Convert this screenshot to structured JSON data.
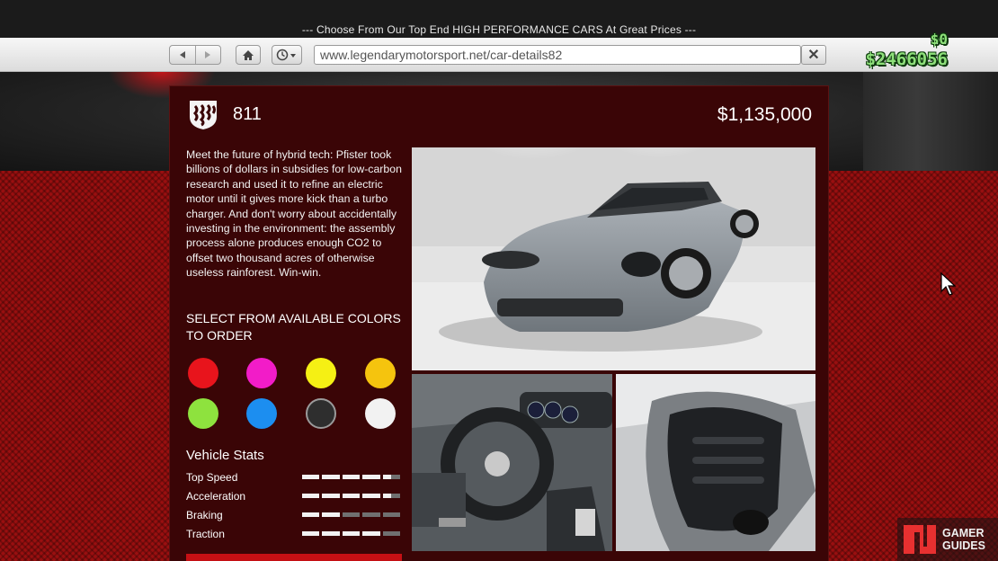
{
  "banner": {
    "title": "--- Choose From Our Top End HIGH PERFORMANCE CARS At Great Prices ---"
  },
  "browser": {
    "back_icon": "back-arrow-icon",
    "forward_icon": "forward-arrow-icon",
    "home_icon": "home-icon",
    "history_icon": "history-clock-icon",
    "url": "www.legendarymotorsport.net/car-details82",
    "close_icon": "close-icon",
    "close_label": "✕"
  },
  "hud": {
    "cash_small": "$0",
    "cash_big": "$2466056"
  },
  "car": {
    "name": "811",
    "price": "$1,135,000",
    "brand_logo": "pfister-logo",
    "description": "Meet the future of hybrid tech: Pfister took billions of dollars in subsidies for low-carbon research and used it to refine an electric motor until it gives more kick than a turbo charger. And don't worry about accidentally investing in the environment: the assembly process alone produces enough CO2 to offset two thousand acres of otherwise useless rainforest. Win-win."
  },
  "colors": {
    "heading": "SELECT FROM AVAILABLE COLORS TO ORDER",
    "swatches": [
      {
        "hex": "#e8141c"
      },
      {
        "hex": "#f21cc8"
      },
      {
        "hex": "#f5f014"
      },
      {
        "hex": "#f5c40e"
      },
      {
        "hex": "#8ee23e"
      },
      {
        "hex": "#1c8ef0"
      },
      {
        "hex": "#2e2e2e",
        "selected": true
      },
      {
        "hex": "#f2f2f2"
      }
    ]
  },
  "stats": {
    "heading": "Vehicle Stats",
    "items": [
      {
        "label": "Top Speed",
        "fraction": 0.9
      },
      {
        "label": "Acceleration",
        "fraction": 0.9
      },
      {
        "label": "Braking",
        "fraction": 0.4
      },
      {
        "label": "Traction",
        "fraction": 0.8
      }
    ]
  },
  "images": {
    "main": "car-exterior-photo",
    "interior": "car-interior-photo",
    "engine": "car-engine-photo"
  },
  "watermark": {
    "line1": "GAMER",
    "line2": "GUIDES"
  }
}
